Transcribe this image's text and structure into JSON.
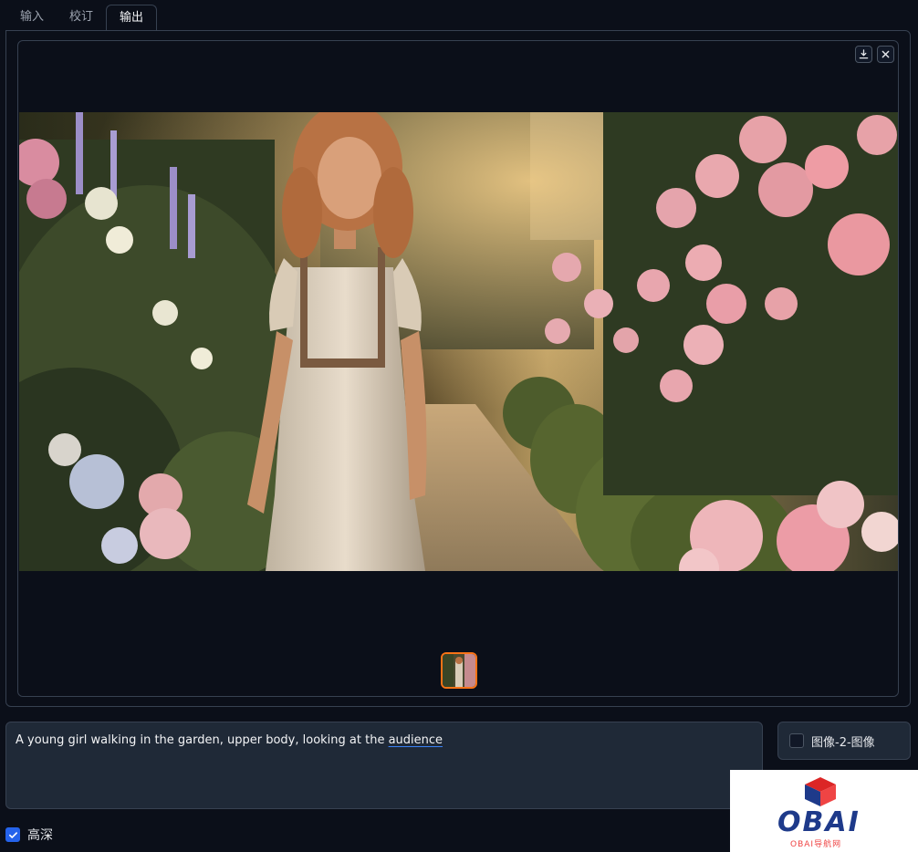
{
  "tabs": [
    {
      "label": "输入",
      "active": false
    },
    {
      "label": "校订",
      "active": false
    },
    {
      "label": "输出",
      "active": true
    }
  ],
  "gallery": {
    "download_icon": "download-icon",
    "close_icon": "close-icon",
    "selected_thumbnail_index": 0
  },
  "prompt": {
    "text_before": "A young girl walking in the garden, upper body, looking at the ",
    "text_underlined": "audience"
  },
  "mode": {
    "label": "图像-2-图像",
    "checked": false
  },
  "hd": {
    "label": "高深",
    "checked": true
  },
  "watermark": {
    "brand": "OBAI",
    "sub": "OBAI导航网"
  },
  "colors": {
    "background": "#0b0f19",
    "accent": "#f97316",
    "checkbox": "#2563eb"
  }
}
